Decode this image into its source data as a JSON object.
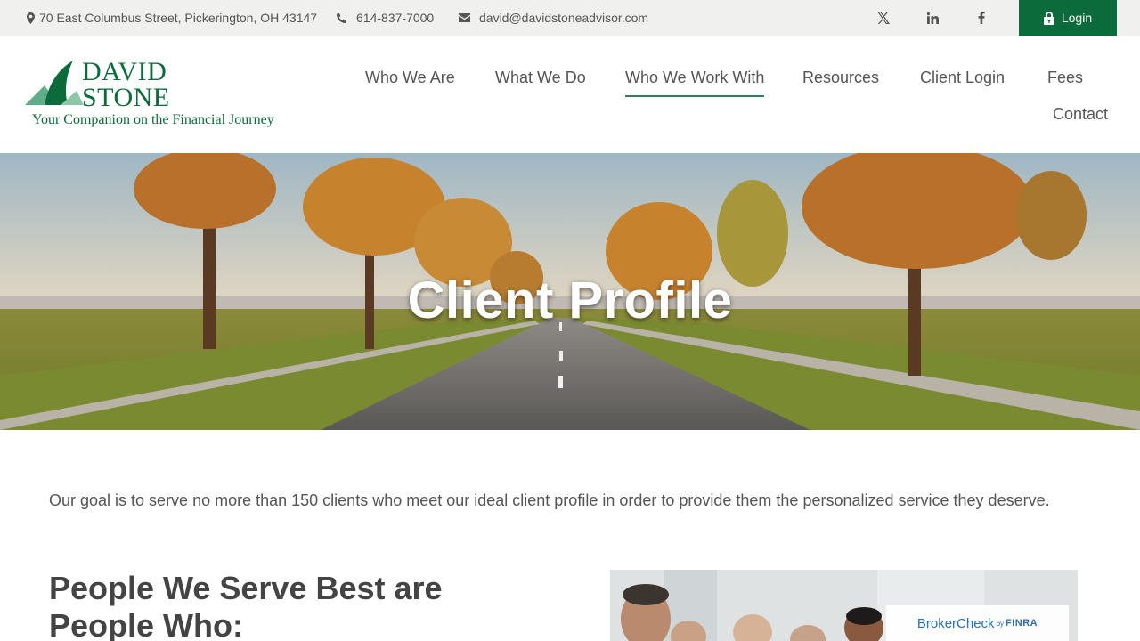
{
  "topbar": {
    "address": "70 East Columbus Street, Pickerington, OH 43147",
    "phone": "614-837-7000",
    "email": "david@davidstoneadvisor.com",
    "login_label": "Login"
  },
  "logo": {
    "name_line1": "DAVID",
    "name_line2": "STONE",
    "tagline": "Your Companion on the Financial Journey"
  },
  "nav": {
    "items": [
      "Who We Are",
      "What We Do",
      "Who We Work With",
      "Resources",
      "Client Login",
      "Fees",
      "Contact"
    ],
    "active": "Who We Work With"
  },
  "hero": {
    "title": "Client Profile"
  },
  "main": {
    "intro": "Our goal is to serve no more than 150 clients who meet our ideal client profile in order to provide them the personalized service they deserve.",
    "heading": "People We Serve Best are People Who:"
  },
  "brokercheck": {
    "brand": "BrokerCheck",
    "by": "by",
    "org": "FINRA"
  },
  "colors": {
    "brand_green": "#0c6b3a",
    "text_gray": "#555555",
    "topbar_bg": "#f0f0ee"
  }
}
